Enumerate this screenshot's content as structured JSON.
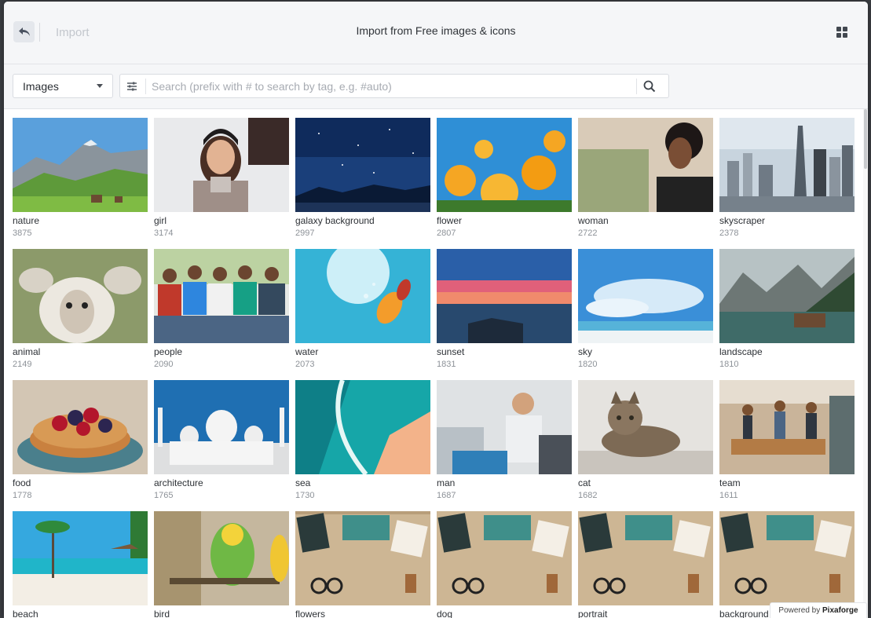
{
  "header": {
    "back_icon": "undo-arrow-icon",
    "import_label": "Import",
    "title": "Import from Free images & icons",
    "layout_icon": "grid-view-icon"
  },
  "toolbar": {
    "type_select": "Images",
    "filter_icon": "sliders-icon",
    "search_placeholder": "Search (prefix with # to search by tag, e.g. #auto)",
    "search_value": "",
    "search_icon": "search-icon"
  },
  "tiles": [
    {
      "tag": "nature",
      "count": "3875"
    },
    {
      "tag": "girl",
      "count": "3174"
    },
    {
      "tag": "galaxy background",
      "count": "2997"
    },
    {
      "tag": "flower",
      "count": "2807"
    },
    {
      "tag": "woman",
      "count": "2722"
    },
    {
      "tag": "skyscraper",
      "count": "2378"
    },
    {
      "tag": "animal",
      "count": "2149"
    },
    {
      "tag": "people",
      "count": "2090"
    },
    {
      "tag": "water",
      "count": "2073"
    },
    {
      "tag": "sunset",
      "count": "1831"
    },
    {
      "tag": "sky",
      "count": "1820"
    },
    {
      "tag": "landscape",
      "count": "1810"
    },
    {
      "tag": "food",
      "count": "1778"
    },
    {
      "tag": "architecture",
      "count": "1765"
    },
    {
      "tag": "sea",
      "count": "1730"
    },
    {
      "tag": "man",
      "count": "1687"
    },
    {
      "tag": "cat",
      "count": "1682"
    },
    {
      "tag": "team",
      "count": "1611"
    },
    {
      "tag": "beach",
      "count": ""
    },
    {
      "tag": "bird",
      "count": ""
    },
    {
      "tag": "flowers",
      "count": ""
    },
    {
      "tag": "dog",
      "count": ""
    },
    {
      "tag": "portrait",
      "count": ""
    },
    {
      "tag": "background",
      "count": ""
    }
  ],
  "footer": {
    "powered_prefix": "Powered by",
    "powered_brand": "Pixaforge"
  }
}
